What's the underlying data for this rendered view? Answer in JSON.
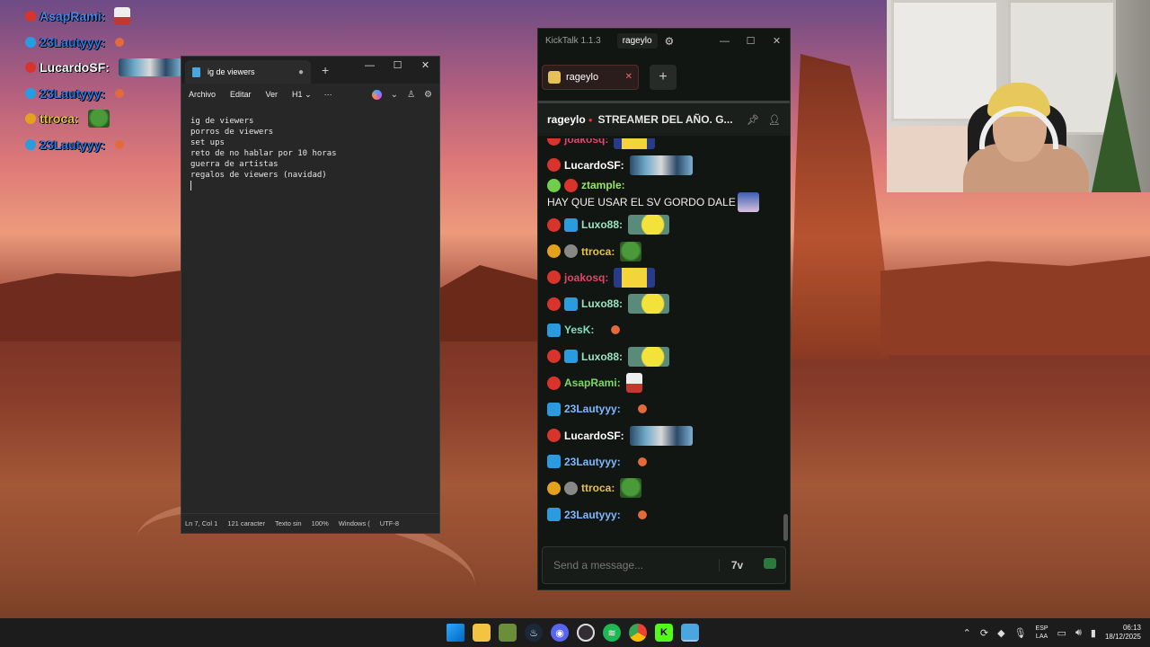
{
  "overlay": {
    "items": [
      {
        "name": "AsapRami:",
        "color": "#c93030",
        "name_color": "#4a86e8",
        "badge": "red",
        "emote": "hat"
      },
      {
        "name": "23Lautyyy:",
        "color": "#2b88d8",
        "name_color": "#2b78e4",
        "badge": "blue",
        "emote": "small"
      },
      {
        "name": "LucardoSF:",
        "color": "#d94040",
        "name_color": "#ffffff",
        "badge": "red",
        "emote": "wide"
      },
      {
        "name": "23Lautyyy:",
        "color": "#2b88d8",
        "name_color": "#2b78e4",
        "badge": "blue",
        "emote": "small"
      },
      {
        "name": "ttroca:",
        "color": "#e2a21e",
        "name_color": "#e5c24a",
        "badge": "gold",
        "emote": "pepe"
      },
      {
        "name": "23Lautyyy:",
        "color": "#2b88d8",
        "name_color": "#2b78e4",
        "badge": "blue",
        "emote": "small"
      }
    ]
  },
  "notepad": {
    "tab_title": "ig de viewers",
    "tab_dot": "●",
    "tab_new": "+",
    "win": {
      "minimize": "—",
      "maximize": "☐",
      "close": "✕"
    },
    "menu": {
      "file": "Archivo",
      "edit": "Editar",
      "view": "Ver",
      "heading": "H1",
      "more": "···"
    },
    "lines": [
      "ig de viewers",
      "porros de viewers",
      "set ups",
      "reto de no hablar por 10 horas",
      "guerra de artistas",
      "regalos de viewers (navidad)"
    ],
    "status": {
      "position": "Ln 7, Col 1",
      "chars": "121 caracter",
      "format": "Texto sin",
      "zoom": "100%",
      "line_ending": "Windows (",
      "encoding": "UTF-8"
    }
  },
  "kicktalk": {
    "app_title": "KickTalk 1.1.3",
    "user": "rageylo",
    "win": {
      "minimize": "—",
      "maximize": "☐",
      "close": "✕"
    },
    "tab": {
      "label": "rageylo",
      "close": "✕"
    },
    "add_tab": "+",
    "header": {
      "channel": "rageylo",
      "live_dot": "●",
      "stream_title": "STREAMER DEL AÑO. G..."
    },
    "messages": [
      {
        "user": "joakosq:",
        "color": "#e0466a",
        "badges": [
          "red"
        ],
        "text": "",
        "emote": "minion"
      },
      {
        "user": "LucardoSF:",
        "color": "#ffffff",
        "badges": [
          "red"
        ],
        "text": "",
        "emote": "wide"
      },
      {
        "user": "ztample:",
        "color": "#9be36b",
        "badges": [
          "green",
          "red"
        ],
        "text": "HAY QUE USAR EL SV GORDO DALE",
        "emote": "face"
      },
      {
        "user": "Luxo88:",
        "color": "#9be3c0",
        "badges": [
          "red",
          "blue"
        ],
        "text": "",
        "emote": "yellow"
      },
      {
        "user": "ttroca:",
        "color": "#e5c24a",
        "badges": [
          "gold",
          "grey"
        ],
        "text": "",
        "emote": "pepe"
      },
      {
        "user": "joakosq:",
        "color": "#e0466a",
        "badges": [
          "red"
        ],
        "text": "",
        "emote": "minion"
      },
      {
        "user": "Luxo88:",
        "color": "#9be3c0",
        "badges": [
          "red",
          "blue"
        ],
        "text": "",
        "emote": "yellow"
      },
      {
        "user": "YesK:",
        "color": "#7fe0c0",
        "badges": [
          "blue"
        ],
        "text": "",
        "emote": "small"
      },
      {
        "user": "Luxo88:",
        "color": "#9be3c0",
        "badges": [
          "red",
          "blue"
        ],
        "text": "",
        "emote": "yellow"
      },
      {
        "user": "AsapRami:",
        "color": "#7fd66a",
        "badges": [
          "red"
        ],
        "text": "",
        "emote": "hat"
      },
      {
        "user": "23Lautyyy:",
        "color": "#7fb8ff",
        "badges": [
          "blue"
        ],
        "text": "",
        "emote": "small"
      },
      {
        "user": "LucardoSF:",
        "color": "#ffffff",
        "badges": [
          "red"
        ],
        "text": "",
        "emote": "wide"
      },
      {
        "user": "23Lautyyy:",
        "color": "#7fb8ff",
        "badges": [
          "blue"
        ],
        "text": "",
        "emote": "small"
      },
      {
        "user": "ttroca:",
        "color": "#e5c24a",
        "badges": [
          "gold",
          "grey"
        ],
        "text": "",
        "emote": "pepe"
      },
      {
        "user": "23Lautyyy:",
        "color": "#7fb8ff",
        "badges": [
          "blue"
        ],
        "text": "",
        "emote": "small"
      }
    ],
    "input_placeholder": "Send a message...",
    "seventv": "7v"
  },
  "taskbar": {
    "apps": [
      "start-icon",
      "file-explorer-icon",
      "app-icon",
      "steam-icon",
      "discord-icon",
      "obs-icon",
      "spotify-icon",
      "chrome-icon",
      "kick-icon",
      "notepad-icon"
    ],
    "tray": {
      "lang_1": "ESP",
      "lang_2": "LAA",
      "time": "06:13",
      "date": "18/12/2025"
    }
  },
  "colors": {
    "kick_green": "#53fc18",
    "notepad_bg": "#272727",
    "kicktalk_bg": "#121613"
  }
}
